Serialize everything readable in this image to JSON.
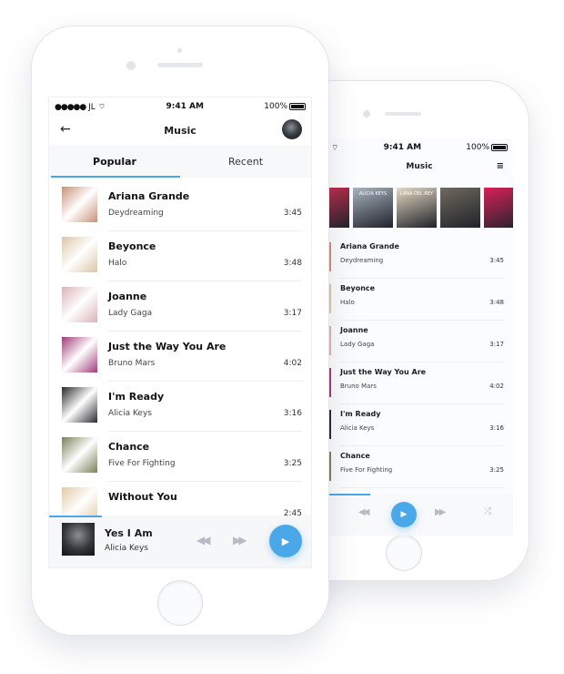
{
  "front": {
    "status": {
      "carrier": "JL",
      "time": "9:41 AM",
      "battery": "100%"
    },
    "title": "Music",
    "tabs": [
      {
        "label": "Popular",
        "active": true
      },
      {
        "label": "Recent",
        "active": false
      }
    ],
    "songs": [
      {
        "title": "Ariana Grande",
        "artist": "Deydreaming",
        "duration": "3:45",
        "cover": "#c98f7a"
      },
      {
        "title": "Beyonce",
        "artist": "Halo",
        "duration": "3:48",
        "cover": "#d9c7a8"
      },
      {
        "title": "Joanne",
        "artist": "Lady Gaga",
        "duration": "3:17",
        "cover": "#d9b3b8"
      },
      {
        "title": "Just the Way You Are",
        "artist": "Bruno Mars",
        "duration": "4:02",
        "cover": "#a03a78"
      },
      {
        "title": "I'm Ready",
        "artist": "Alicia Keys",
        "duration": "3:16",
        "cover": "#2a2a2e"
      },
      {
        "title": "Chance",
        "artist": "Five For Fighting",
        "duration": "3:25",
        "cover": "#7b7f5a"
      },
      {
        "title": "Without You",
        "artist": "",
        "duration": "2:45",
        "cover": "#e0caa5"
      }
    ],
    "now_playing": {
      "title": "Yes I Am",
      "artist": "Alicia Keys",
      "progress": 0.2
    }
  },
  "back": {
    "status": {
      "time": "9:41 AM",
      "battery": "100%"
    },
    "title": "Music",
    "covers": [
      "#d42c4e",
      "#a9b3c0",
      "#e6d9c4",
      "#6f6a5e",
      "#d82158"
    ],
    "cover_text": [
      "",
      "ALICIA KEYS",
      "LANA DEL REY",
      "",
      ""
    ],
    "songs": [
      {
        "title": "Ariana Grande",
        "artist": "Deydreaming",
        "duration": "3:45",
        "cover": "#c98f7a"
      },
      {
        "title": "Beyonce",
        "artist": "Halo",
        "duration": "3:48",
        "cover": "#d9c7a8"
      },
      {
        "title": "Joanne",
        "artist": "Lady Gaga",
        "duration": "3:17",
        "cover": "#d9b3b8"
      },
      {
        "title": "Just the Way You Are",
        "artist": "Bruno Mars",
        "duration": "4:02",
        "cover": "#a03a78"
      },
      {
        "title": "I'm Ready",
        "artist": "Alicia Keys",
        "duration": "3:16",
        "cover": "#2a2a2e"
      },
      {
        "title": "Chance",
        "artist": "Five For Fighting",
        "duration": "3:25",
        "cover": "#7b7f5a"
      }
    ],
    "progress": 0.24
  },
  "accent": "#4aa7e8"
}
